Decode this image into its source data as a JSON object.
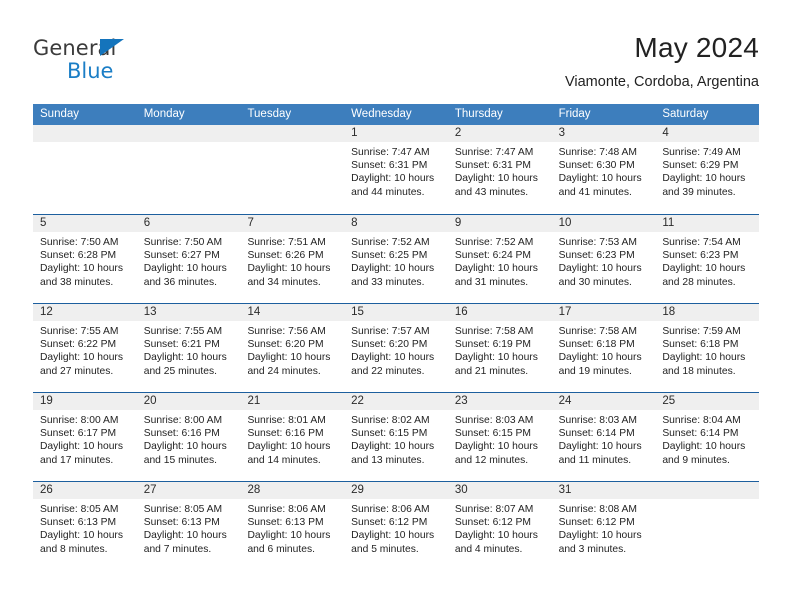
{
  "brand": {
    "name_line1": "General",
    "name_line2": "Blue",
    "triangle_icon": "triangle-icon",
    "color_primary": "#1b7ec6",
    "color_text": "#3b3b3b"
  },
  "header": {
    "month_title": "May 2024",
    "location": "Viamonte, Cordoba, Argentina"
  },
  "theme": {
    "header_blue": "#3d7ebd",
    "row_divider_blue": "#1d5f9e",
    "datebar_grey": "#efefef",
    "cell_white": "#ffffff"
  },
  "weekdays": [
    "Sunday",
    "Monday",
    "Tuesday",
    "Wednesday",
    "Thursday",
    "Friday",
    "Saturday"
  ],
  "labels": {
    "sunrise_prefix": "Sunrise: ",
    "sunset_prefix": "Sunset: ",
    "daylight_prefix": "Daylight: "
  },
  "weeks": [
    [
      {
        "date": "",
        "empty": true
      },
      {
        "date": "",
        "empty": true
      },
      {
        "date": "",
        "empty": true
      },
      {
        "date": "1",
        "sunrise": "Sunrise: 7:47 AM",
        "sunset": "Sunset: 6:31 PM",
        "daylight_1": "Daylight: 10 hours",
        "daylight_2": "and 44 minutes."
      },
      {
        "date": "2",
        "sunrise": "Sunrise: 7:47 AM",
        "sunset": "Sunset: 6:31 PM",
        "daylight_1": "Daylight: 10 hours",
        "daylight_2": "and 43 minutes."
      },
      {
        "date": "3",
        "sunrise": "Sunrise: 7:48 AM",
        "sunset": "Sunset: 6:30 PM",
        "daylight_1": "Daylight: 10 hours",
        "daylight_2": "and 41 minutes."
      },
      {
        "date": "4",
        "sunrise": "Sunrise: 7:49 AM",
        "sunset": "Sunset: 6:29 PM",
        "daylight_1": "Daylight: 10 hours",
        "daylight_2": "and 39 minutes."
      }
    ],
    [
      {
        "date": "5",
        "sunrise": "Sunrise: 7:50 AM",
        "sunset": "Sunset: 6:28 PM",
        "daylight_1": "Daylight: 10 hours",
        "daylight_2": "and 38 minutes."
      },
      {
        "date": "6",
        "sunrise": "Sunrise: 7:50 AM",
        "sunset": "Sunset: 6:27 PM",
        "daylight_1": "Daylight: 10 hours",
        "daylight_2": "and 36 minutes."
      },
      {
        "date": "7",
        "sunrise": "Sunrise: 7:51 AM",
        "sunset": "Sunset: 6:26 PM",
        "daylight_1": "Daylight: 10 hours",
        "daylight_2": "and 34 minutes."
      },
      {
        "date": "8",
        "sunrise": "Sunrise: 7:52 AM",
        "sunset": "Sunset: 6:25 PM",
        "daylight_1": "Daylight: 10 hours",
        "daylight_2": "and 33 minutes."
      },
      {
        "date": "9",
        "sunrise": "Sunrise: 7:52 AM",
        "sunset": "Sunset: 6:24 PM",
        "daylight_1": "Daylight: 10 hours",
        "daylight_2": "and 31 minutes."
      },
      {
        "date": "10",
        "sunrise": "Sunrise: 7:53 AM",
        "sunset": "Sunset: 6:23 PM",
        "daylight_1": "Daylight: 10 hours",
        "daylight_2": "and 30 minutes."
      },
      {
        "date": "11",
        "sunrise": "Sunrise: 7:54 AM",
        "sunset": "Sunset: 6:23 PM",
        "daylight_1": "Daylight: 10 hours",
        "daylight_2": "and 28 minutes."
      }
    ],
    [
      {
        "date": "12",
        "sunrise": "Sunrise: 7:55 AM",
        "sunset": "Sunset: 6:22 PM",
        "daylight_1": "Daylight: 10 hours",
        "daylight_2": "and 27 minutes."
      },
      {
        "date": "13",
        "sunrise": "Sunrise: 7:55 AM",
        "sunset": "Sunset: 6:21 PM",
        "daylight_1": "Daylight: 10 hours",
        "daylight_2": "and 25 minutes."
      },
      {
        "date": "14",
        "sunrise": "Sunrise: 7:56 AM",
        "sunset": "Sunset: 6:20 PM",
        "daylight_1": "Daylight: 10 hours",
        "daylight_2": "and 24 minutes."
      },
      {
        "date": "15",
        "sunrise": "Sunrise: 7:57 AM",
        "sunset": "Sunset: 6:20 PM",
        "daylight_1": "Daylight: 10 hours",
        "daylight_2": "and 22 minutes."
      },
      {
        "date": "16",
        "sunrise": "Sunrise: 7:58 AM",
        "sunset": "Sunset: 6:19 PM",
        "daylight_1": "Daylight: 10 hours",
        "daylight_2": "and 21 minutes."
      },
      {
        "date": "17",
        "sunrise": "Sunrise: 7:58 AM",
        "sunset": "Sunset: 6:18 PM",
        "daylight_1": "Daylight: 10 hours",
        "daylight_2": "and 19 minutes."
      },
      {
        "date": "18",
        "sunrise": "Sunrise: 7:59 AM",
        "sunset": "Sunset: 6:18 PM",
        "daylight_1": "Daylight: 10 hours",
        "daylight_2": "and 18 minutes."
      }
    ],
    [
      {
        "date": "19",
        "sunrise": "Sunrise: 8:00 AM",
        "sunset": "Sunset: 6:17 PM",
        "daylight_1": "Daylight: 10 hours",
        "daylight_2": "and 17 minutes."
      },
      {
        "date": "20",
        "sunrise": "Sunrise: 8:00 AM",
        "sunset": "Sunset: 6:16 PM",
        "daylight_1": "Daylight: 10 hours",
        "daylight_2": "and 15 minutes."
      },
      {
        "date": "21",
        "sunrise": "Sunrise: 8:01 AM",
        "sunset": "Sunset: 6:16 PM",
        "daylight_1": "Daylight: 10 hours",
        "daylight_2": "and 14 minutes."
      },
      {
        "date": "22",
        "sunrise": "Sunrise: 8:02 AM",
        "sunset": "Sunset: 6:15 PM",
        "daylight_1": "Daylight: 10 hours",
        "daylight_2": "and 13 minutes."
      },
      {
        "date": "23",
        "sunrise": "Sunrise: 8:03 AM",
        "sunset": "Sunset: 6:15 PM",
        "daylight_1": "Daylight: 10 hours",
        "daylight_2": "and 12 minutes."
      },
      {
        "date": "24",
        "sunrise": "Sunrise: 8:03 AM",
        "sunset": "Sunset: 6:14 PM",
        "daylight_1": "Daylight: 10 hours",
        "daylight_2": "and 11 minutes."
      },
      {
        "date": "25",
        "sunrise": "Sunrise: 8:04 AM",
        "sunset": "Sunset: 6:14 PM",
        "daylight_1": "Daylight: 10 hours",
        "daylight_2": "and 9 minutes."
      }
    ],
    [
      {
        "date": "26",
        "sunrise": "Sunrise: 8:05 AM",
        "sunset": "Sunset: 6:13 PM",
        "daylight_1": "Daylight: 10 hours",
        "daylight_2": "and 8 minutes."
      },
      {
        "date": "27",
        "sunrise": "Sunrise: 8:05 AM",
        "sunset": "Sunset: 6:13 PM",
        "daylight_1": "Daylight: 10 hours",
        "daylight_2": "and 7 minutes."
      },
      {
        "date": "28",
        "sunrise": "Sunrise: 8:06 AM",
        "sunset": "Sunset: 6:13 PM",
        "daylight_1": "Daylight: 10 hours",
        "daylight_2": "and 6 minutes."
      },
      {
        "date": "29",
        "sunrise": "Sunrise: 8:06 AM",
        "sunset": "Sunset: 6:12 PM",
        "daylight_1": "Daylight: 10 hours",
        "daylight_2": "and 5 minutes."
      },
      {
        "date": "30",
        "sunrise": "Sunrise: 8:07 AM",
        "sunset": "Sunset: 6:12 PM",
        "daylight_1": "Daylight: 10 hours",
        "daylight_2": "and 4 minutes."
      },
      {
        "date": "31",
        "sunrise": "Sunrise: 8:08 AM",
        "sunset": "Sunset: 6:12 PM",
        "daylight_1": "Daylight: 10 hours",
        "daylight_2": "and 3 minutes."
      },
      {
        "date": "",
        "empty": true
      }
    ]
  ]
}
